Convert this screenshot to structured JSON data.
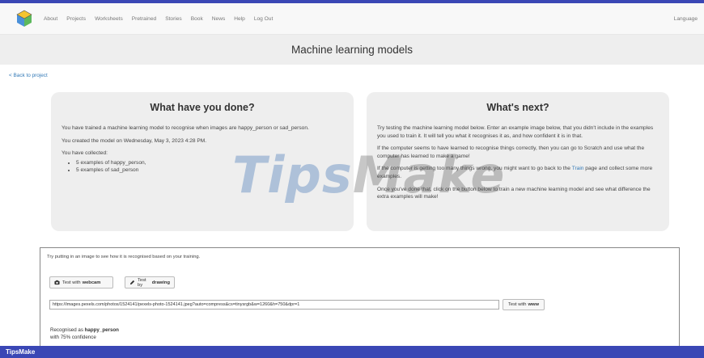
{
  "nav": {
    "items": [
      "About",
      "Projects",
      "Worksheets",
      "Pretrained",
      "Stories",
      "Book",
      "News",
      "Help",
      "Log Out"
    ],
    "language": "Language"
  },
  "page_title": "Machine learning models",
  "back_link": "< Back to project",
  "left_panel": {
    "heading": "What have you done?",
    "p1": "You have trained a machine learning model to recognise when images are happy_person or sad_person.",
    "p2": "You created the model on Wednesday, May 3, 2023 4:28 PM.",
    "p3": "You have collected:",
    "items": [
      "5 examples of happy_person,",
      "5 examples of sad_person"
    ]
  },
  "right_panel": {
    "heading": "What's next?",
    "p1": "Try testing the machine learning model below. Enter an example image below, that you didn't include in the examples you used to train it. It will tell you what it recognises it as, and how confident it is in that.",
    "p2": "If the computer seems to have learned to recognise things correctly, then you can go to Scratch and use what the computer has learned to make a game!",
    "p3_before": "If the computer is getting too many things wrong, you might want to go back to the ",
    "p3_link": "Train",
    "p3_after": " page and collect some more examples.",
    "p4": "Once you've done that, click on the button below to train a new machine learning model and see what difference the extra examples will make!"
  },
  "test": {
    "prompt": "Try putting in an image to see how it is recognised based on your training.",
    "webcam_label": "Test with ",
    "webcam_bold": "webcam",
    "drawing_label": "Test by ",
    "drawing_bold": "drawing",
    "url_value": "https://images.pexels.com/photos/1524141/pexels-photo-1524141.jpeg?auto=compress&cs=tinysrgb&w=1260&h=750&dpr=1",
    "www_label": "Test with ",
    "www_bold": "www",
    "result_prefix": "Recognised as ",
    "result_label": "happy_person",
    "result_confidence": "with 75% confidence"
  },
  "watermark": {
    "part1": "Tips",
    "part2": "Make"
  },
  "footer": {
    "brand": "TipsMake"
  },
  "colors": {
    "accent": "#3a47b5",
    "link": "#337ab7",
    "panel_bg": "#eeeeee"
  }
}
